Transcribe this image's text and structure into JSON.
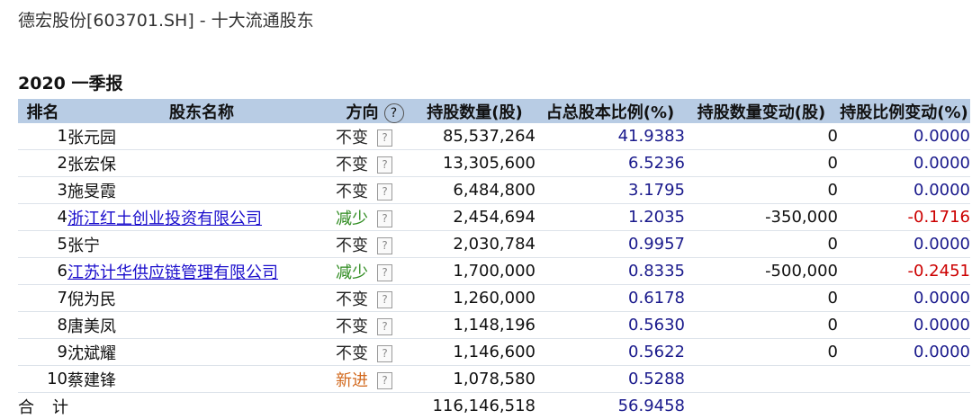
{
  "page": {
    "title": "德宏股份[603701.SH] - 十大流通股东",
    "period": "2020 一季报"
  },
  "headers": {
    "rank": "排名",
    "name": "股东名称",
    "direction": "方向",
    "help_icon": "?",
    "shares": "持股数量(股)",
    "ratio": "占总股本比例(%)",
    "shares_change": "持股数量变动(股)",
    "ratio_change": "持股比例变动(%)"
  },
  "help_box_glyph": "?",
  "rows": [
    {
      "rank": "1",
      "name": "张元园",
      "link": false,
      "direction": "不变",
      "dir_type": "same",
      "shares": "85,537,264",
      "ratio": "41.9383",
      "shares_change": "0",
      "ratio_change": "0.0000",
      "change_sign": "pos"
    },
    {
      "rank": "2",
      "name": "张宏保",
      "link": false,
      "direction": "不变",
      "dir_type": "same",
      "shares": "13,305,600",
      "ratio": "6.5236",
      "shares_change": "0",
      "ratio_change": "0.0000",
      "change_sign": "pos"
    },
    {
      "rank": "3",
      "name": "施旻霞",
      "link": false,
      "direction": "不变",
      "dir_type": "same",
      "shares": "6,484,800",
      "ratio": "3.1795",
      "shares_change": "0",
      "ratio_change": "0.0000",
      "change_sign": "pos"
    },
    {
      "rank": "4",
      "name": "浙江红土创业投资有限公司",
      "link": true,
      "direction": "减少",
      "dir_type": "down",
      "shares": "2,454,694",
      "ratio": "1.2035",
      "shares_change": "-350,000",
      "ratio_change": "-0.1716",
      "change_sign": "neg"
    },
    {
      "rank": "5",
      "name": "张宁",
      "link": false,
      "direction": "不变",
      "dir_type": "same",
      "shares": "2,030,784",
      "ratio": "0.9957",
      "shares_change": "0",
      "ratio_change": "0.0000",
      "change_sign": "pos"
    },
    {
      "rank": "6",
      "name": "江苏计华供应链管理有限公司",
      "link": true,
      "direction": "减少",
      "dir_type": "down",
      "shares": "1,700,000",
      "ratio": "0.8335",
      "shares_change": "-500,000",
      "ratio_change": "-0.2451",
      "change_sign": "neg"
    },
    {
      "rank": "7",
      "name": "倪为民",
      "link": false,
      "direction": "不变",
      "dir_type": "same",
      "shares": "1,260,000",
      "ratio": "0.6178",
      "shares_change": "0",
      "ratio_change": "0.0000",
      "change_sign": "pos"
    },
    {
      "rank": "8",
      "name": "唐美凤",
      "link": false,
      "direction": "不变",
      "dir_type": "same",
      "shares": "1,148,196",
      "ratio": "0.5630",
      "shares_change": "0",
      "ratio_change": "0.0000",
      "change_sign": "pos"
    },
    {
      "rank": "9",
      "name": "沈斌耀",
      "link": false,
      "direction": "不变",
      "dir_type": "same",
      "shares": "1,146,600",
      "ratio": "0.5622",
      "shares_change": "0",
      "ratio_change": "0.0000",
      "change_sign": "pos"
    },
    {
      "rank": "10",
      "name": "蔡建锋",
      "link": false,
      "direction": "新进",
      "dir_type": "new",
      "shares": "1,078,580",
      "ratio": "0.5288",
      "shares_change": "",
      "ratio_change": "",
      "change_sign": "pos"
    }
  ],
  "total": {
    "label": "合计",
    "shares": "116,146,518",
    "ratio": "56.9458"
  },
  "colors": {
    "header_bg": "#b8cce4",
    "link": "#1a0dcc",
    "ratio_text": "#1a1a8c",
    "negative": "#cc0000",
    "decrease": "#2e8b1f",
    "new_entry": "#d2691e"
  }
}
